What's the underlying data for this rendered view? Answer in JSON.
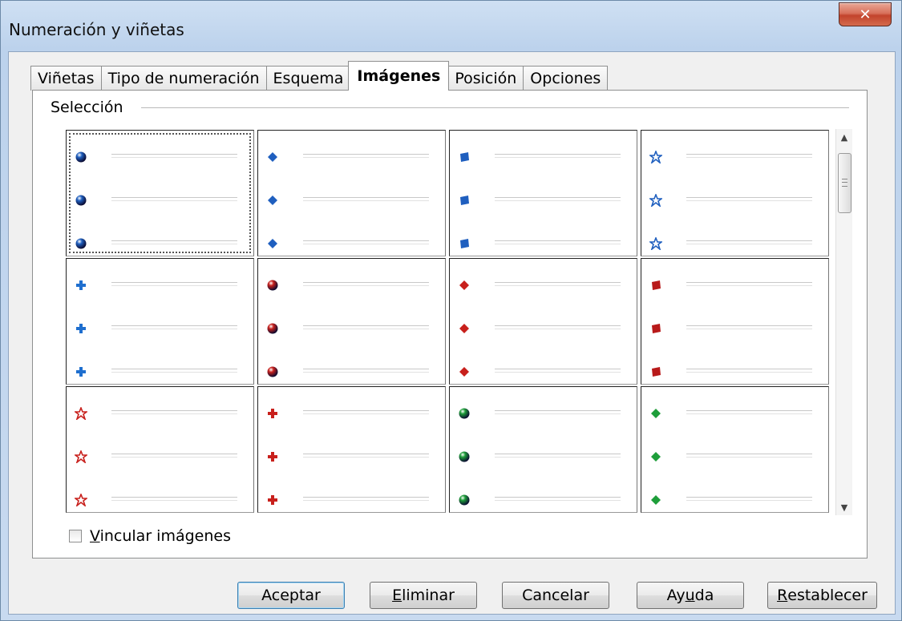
{
  "window": {
    "title": "Numeración y viñetas",
    "close_label": "✕"
  },
  "tabs": [
    {
      "label": "Viñetas",
      "active": false
    },
    {
      "label": "Tipo de numeración",
      "active": false
    },
    {
      "label": "Esquema",
      "active": false
    },
    {
      "label": "Imágenes",
      "active": true
    },
    {
      "label": "Posición",
      "active": false
    },
    {
      "label": "Opciones",
      "active": false
    }
  ],
  "selection": {
    "label": "Selección",
    "items": [
      {
        "icon": "blue-sphere-icon",
        "color": "#1f5fbf",
        "shape": "sphere",
        "selected": true
      },
      {
        "icon": "blue-diamond-icon",
        "color": "#1f5fbf",
        "shape": "diamond"
      },
      {
        "icon": "blue-square-icon",
        "color": "#1f5fbf",
        "shape": "square"
      },
      {
        "icon": "blue-star-icon",
        "color": "#1f5fbf",
        "shape": "star"
      },
      {
        "icon": "blue-cross-icon",
        "color": "#1f6fcf",
        "shape": "cross"
      },
      {
        "icon": "red-sphere-icon",
        "color": "#c8201c",
        "shape": "sphere"
      },
      {
        "icon": "red-diamond-icon",
        "color": "#c8201c",
        "shape": "diamond"
      },
      {
        "icon": "red-square-icon",
        "color": "#b81a1a",
        "shape": "square"
      },
      {
        "icon": "red-star-icon",
        "color": "#c8201c",
        "shape": "star"
      },
      {
        "icon": "red-cross-icon",
        "color": "#c8201c",
        "shape": "cross"
      },
      {
        "icon": "green-sphere-icon",
        "color": "#1e9e3a",
        "shape": "sphere"
      },
      {
        "icon": "green-diamond-icon",
        "color": "#1e9e3a",
        "shape": "diamond"
      }
    ]
  },
  "link_images": {
    "label_underlined": "V",
    "label_rest": "incular imágenes",
    "checked": false
  },
  "buttons": {
    "accept": "Aceptar",
    "delete_u": "E",
    "delete_rest": "liminar",
    "cancel": "Cancelar",
    "help_pre": "Ay",
    "help_u": "u",
    "help_rest": "da",
    "reset_u": "R",
    "reset_rest": "establecer"
  }
}
